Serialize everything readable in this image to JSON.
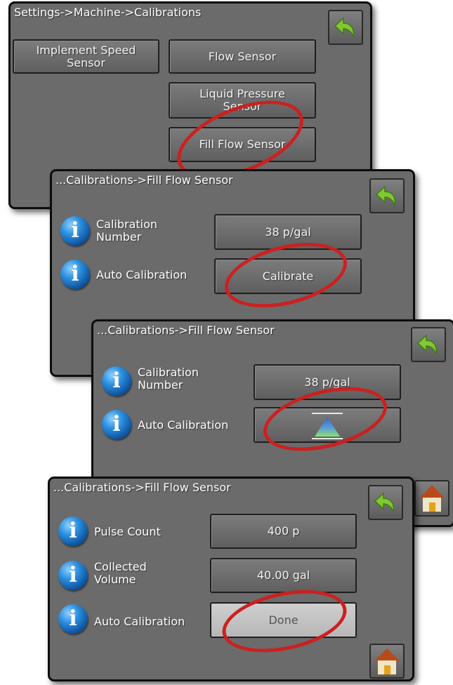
{
  "panel1": {
    "breadcrumb": "Settings->Machine->Calibrations",
    "btn_implement_line1": "Implement Speed",
    "btn_implement_line2": "Sensor",
    "btn_flow": "Flow Sensor",
    "btn_liquid_line1": "Liquid Pressure",
    "btn_liquid_line2": "Sensor",
    "btn_fill_flow": "Fill Flow Sensor"
  },
  "panel2": {
    "breadcrumb": "...Calibrations->Fill Flow Sensor",
    "cal_number_line1": "Calibration",
    "cal_number_line2": "Number",
    "cal_number_value": "38 p/gal",
    "auto_cal_label": "Auto Calibration",
    "auto_cal_button": "Calibrate"
  },
  "panel3": {
    "breadcrumb": "...Calibrations->Fill Flow Sensor",
    "cal_number_line1": "Calibration",
    "cal_number_line2": "Number",
    "cal_number_value": "38 p/gal",
    "auto_cal_label": "Auto Calibration"
  },
  "panel4": {
    "breadcrumb": "...Calibrations->Fill Flow Sensor",
    "pulse_count_label": "Pulse Count",
    "pulse_count_value": "400 p",
    "collected_line1": "Collected",
    "collected_line2": "Volume",
    "collected_value": "40.00 gal",
    "auto_cal_label": "Auto Calibration",
    "done_button": "Done"
  },
  "icons": {
    "back": "back-arrow-icon",
    "home": "home-icon",
    "info": "info-icon",
    "progress": "calibration-progress-icon"
  },
  "colors": {
    "panel_bg": "#6b6b6b",
    "highlight_oval": "#cc2020",
    "back_arrow": "#7fc832",
    "info_blue": "#1f78c8"
  }
}
